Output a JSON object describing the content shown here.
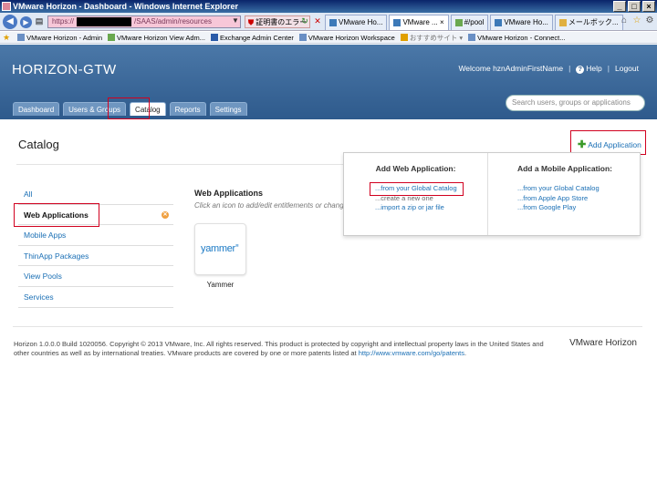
{
  "window": {
    "title": "VMware Horizon - Dashboard - Windows Internet Explorer"
  },
  "browser": {
    "url_prefix": "https://",
    "url_suffix": "/SAAS/admin/resources",
    "cert_error": "証明書のエラー",
    "tabs": [
      {
        "label": "VMware Ho...",
        "active": false
      },
      {
        "label": "VMware ...",
        "active": true
      },
      {
        "label": "#/pool",
        "active": false
      },
      {
        "label": "VMware Ho...",
        "active": false
      },
      {
        "label": "メールボック...",
        "active": false
      }
    ],
    "favorites": [
      "VMware Horizon - Admin",
      "VMware Horizon View Adm...",
      "Exchange Admin Center",
      "VMware Horizon Workspace",
      "おすすめサイト",
      "VMware Horizon - Connect..."
    ]
  },
  "header": {
    "brand": "HORIZON-GTW",
    "welcome": "Welcome hznAdminFirstName",
    "help": "Help",
    "logout": "Logout",
    "tabs": [
      "Dashboard",
      "Users & Groups",
      "Catalog",
      "Reports",
      "Settings"
    ],
    "active_tab": "Catalog",
    "search_placeholder": "Search users, groups or applications"
  },
  "page": {
    "title": "Catalog",
    "add_application": "Add Application"
  },
  "sidebar": {
    "items": [
      "All",
      "Web Applications",
      "Mobile Apps",
      "ThinApp Packages",
      "View Pools",
      "Services"
    ],
    "active": "Web Applications"
  },
  "main": {
    "section_title": "Web Applications",
    "section_hint": "Click an icon to add/edit entitlements or change o",
    "apps": [
      {
        "name": "Yammer",
        "logo_text": "yammer"
      }
    ]
  },
  "add_menu": {
    "web_heading": "Add Web Application:",
    "web_links": [
      "...from your Global Catalog",
      "...create a new one",
      "...import a zip or jar file"
    ],
    "mobile_heading": "Add a Mobile Application:",
    "mobile_links": [
      "...from your Global Catalog",
      "...from Apple App Store",
      "...from Google Play"
    ]
  },
  "footer": {
    "text": "Horizon 1.0.0.0 Build 1020056. Copyright © 2013 VMware, Inc. All rights reserved. This product is protected by copyright and intellectual property laws in the United States and other countries as well as by international treaties. VMware products are covered by one or more patents listed at ",
    "link": "http://www.vmware.com/go/patents",
    "end": ".",
    "brand": "VMware Horizon"
  },
  "colors": {
    "header_bg": "#3b6a9c",
    "link": "#1a6fb5",
    "highlight": "#d1001f",
    "add_icon": "#3a9a2a"
  }
}
